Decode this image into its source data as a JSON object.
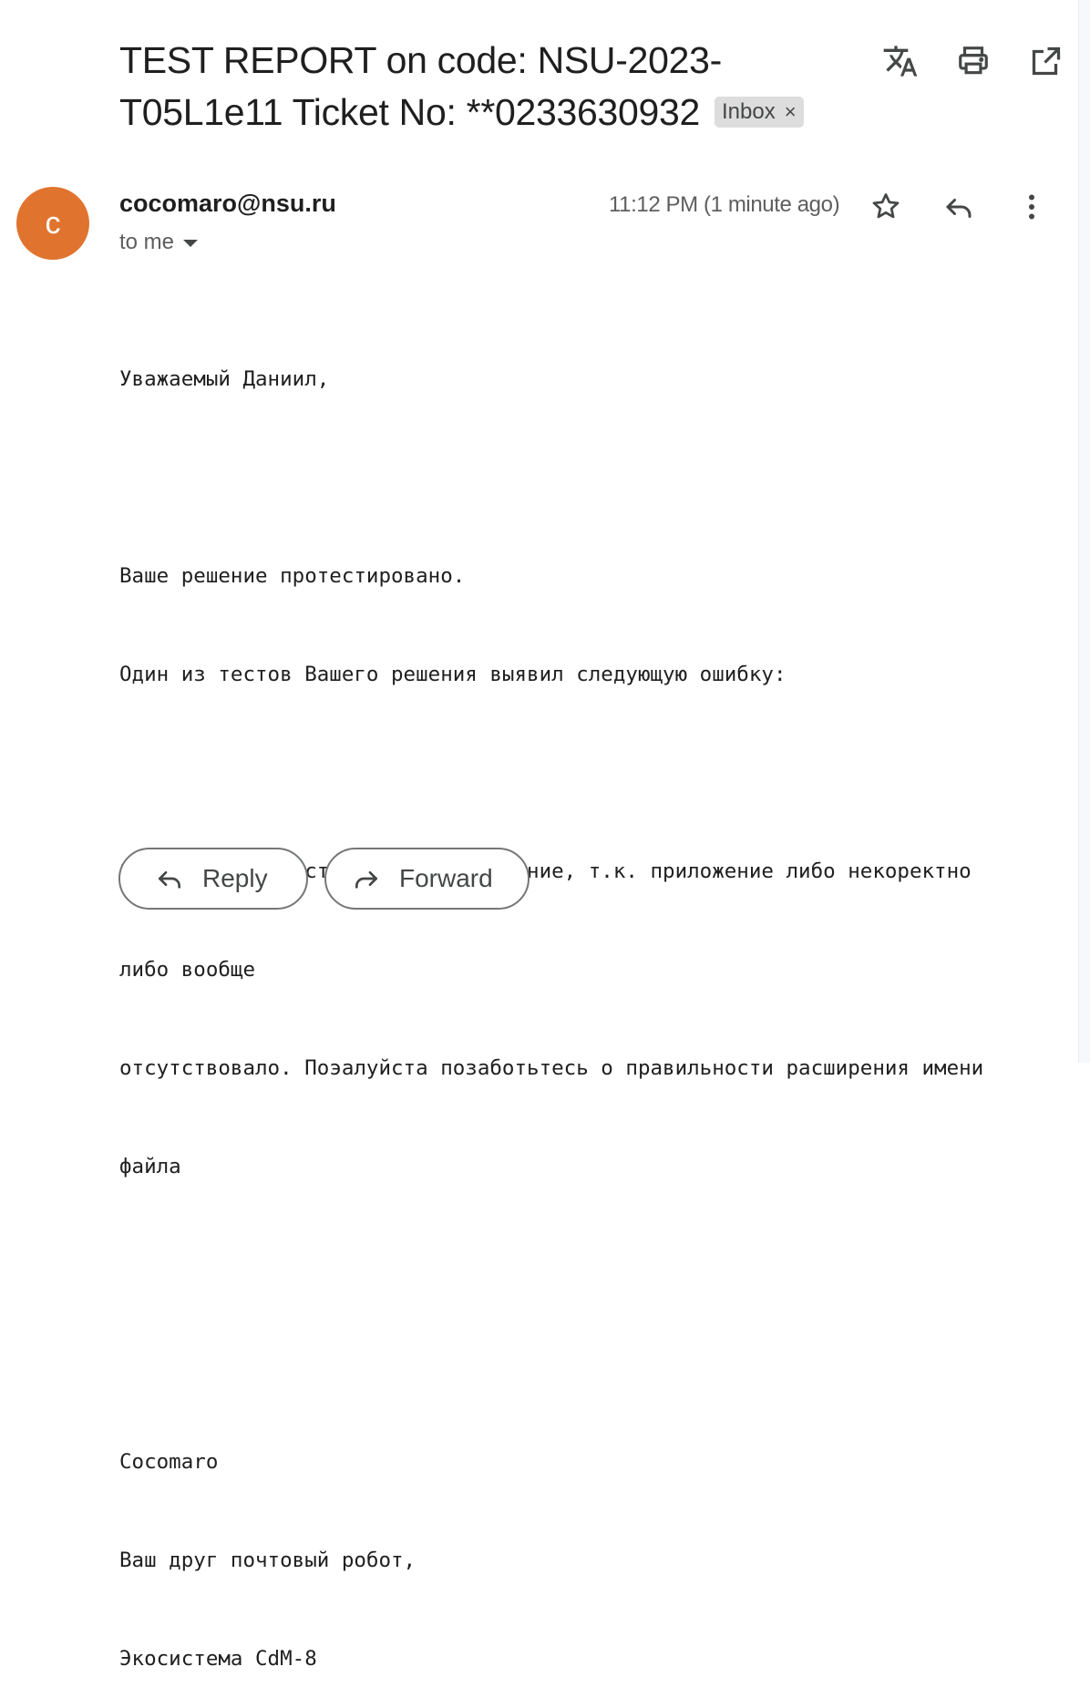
{
  "subject": {
    "text": "TEST REPORT on code: NSU-2023-T05L1e11 Ticket No: **0233630932",
    "line1": "TEST REPORT on code: NSU-2023-",
    "line2": "T05L1e11 Ticket No: **0233630932",
    "label": "Inbox",
    "label_remove": "×"
  },
  "top_actions": {
    "icons": [
      "translate-icon",
      "print-icon",
      "open-in-new-window-icon"
    ]
  },
  "message": {
    "avatar_letter": "c",
    "avatar_color": "#e0742f",
    "sender": "cocomaro@nsu.ru",
    "recipient": "to me",
    "timestamp": "11:12 PM (1 minute ago)",
    "action_icons": [
      "star-icon",
      "reply-icon",
      "more-vert-icon"
    ]
  },
  "body": {
    "lines": [
      "Уважаемый Даниил,",
      "",
      "Ваше решение протестировано.",
      "Один из тестов Вашего решения выявил следующую ошибку:",
      "",
      "Я не смог протестировать это решение, т.к. приложение либо некоректно",
      "либо вообще",
      "отсутствовало. Поэалуйста позаботьтесь о правильности расширения имени",
      "файла",
      "",
      "",
      "Cocomaro",
      "Ваш друг почтовый робот,",
      "Экосистема CdM-8"
    ]
  },
  "buttons": {
    "reply_label": "Reply",
    "forward_label": "Forward"
  }
}
